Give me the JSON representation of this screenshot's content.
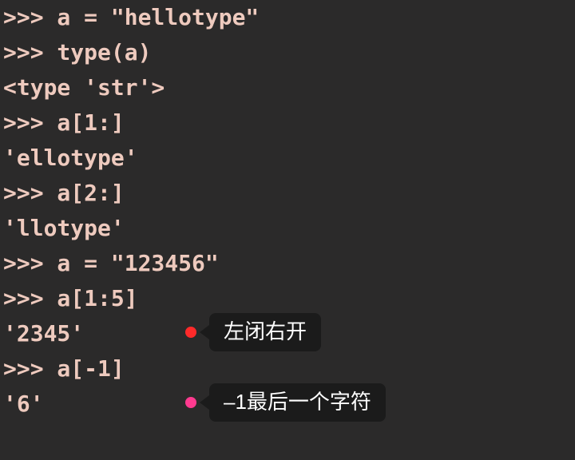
{
  "lines": {
    "l0": ">>> a = \"hellotype\"",
    "l1": ">>> type(a)",
    "l2": "<type 'str'>",
    "l3": ">>> a[1:]",
    "l4": "'ellotype'",
    "l5": ">>> a[2:]",
    "l6": "'llotype'",
    "l7": ">>> a = \"123456\"",
    "l8": ">>> a[1:5]",
    "l9": "'2345'",
    "l10": ">>> a[-1]",
    "l11": "'6'"
  },
  "annotations": {
    "a1": "左闭右开",
    "a2": "–1最后一个字符"
  }
}
